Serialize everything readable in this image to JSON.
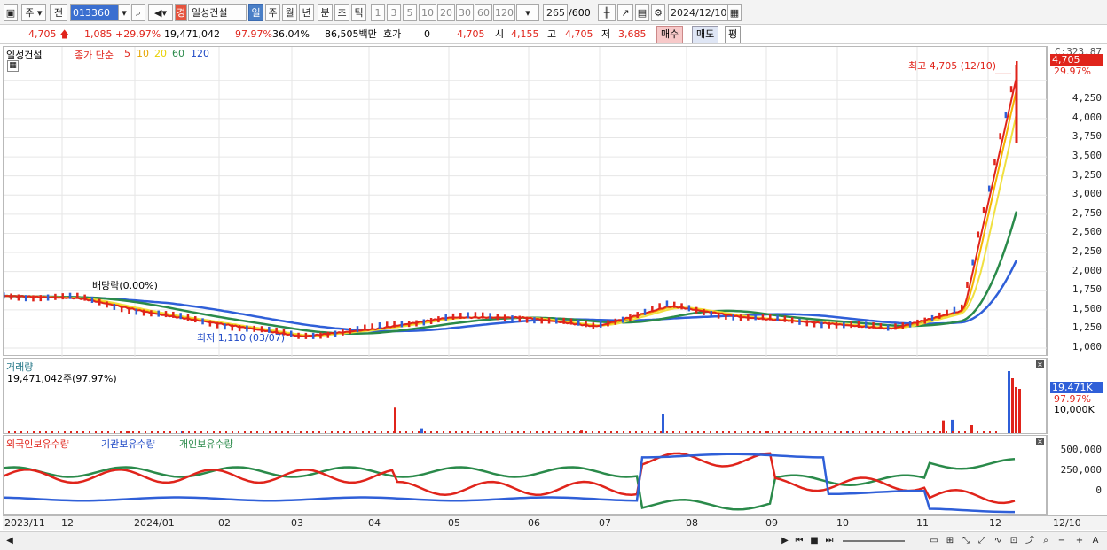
{
  "toolbar": {
    "market": "주",
    "period_prefix": "전",
    "code": "013360",
    "name": "일성건설",
    "name_badge": "경",
    "periods": [
      "일",
      "주",
      "월",
      "년",
      "분",
      "초",
      "틱"
    ],
    "minutes": [
      "1",
      "3",
      "5",
      "10",
      "20",
      "30",
      "60",
      "120"
    ],
    "count": "265",
    "count_max": "/600",
    "date": "2024/12/10"
  },
  "quote": {
    "price": "4,705",
    "change": "1,085",
    "change_pct": "+29.97%",
    "volume": "19,471,042",
    "vol_ratio": "97.97%",
    "turnover": "36.04%",
    "amount": "86,505백만",
    "hoga_label": "호가",
    "hoga_value": "0",
    "ask": "4,705",
    "open_label": "시",
    "open": "4,155",
    "high_label": "고",
    "high": "4,705",
    "low_label": "저",
    "low": "3,685",
    "buy": "매수",
    "sell": "매도",
    "avg": "평"
  },
  "price_panel": {
    "stock_name": "일성건설",
    "ma_label": "종가 단순",
    "ma_periods": [
      "5",
      "10",
      "20",
      "60",
      "120"
    ],
    "ma_colors": [
      "#e0241b",
      "#f5b400",
      "#f0e040",
      "#2a8a4a",
      "#2f5fd8"
    ],
    "annotation_high": "최고 4,705 (12/10)",
    "annotation_low": "최저 1,110 (03/07)",
    "annotation_div": "배당락(0.00%)",
    "axis_top": "C:323.87",
    "current_tag": "4,705",
    "current_pct": "29.97%"
  },
  "volume_panel": {
    "title": "거래량",
    "value": "19,471,042주(97.97%)",
    "tag": "19,471K",
    "tag_pct": "97.97%",
    "axis_label": "10,000K"
  },
  "inst_panel": {
    "labels": [
      "외국인보유수량",
      "기관보유수량",
      "개인보유수량"
    ],
    "colors": [
      "#e0241b",
      "#2f5fd8",
      "#2a8a4a"
    ],
    "ticks": [
      "500,000",
      "250,000",
      "0"
    ]
  },
  "x_labels": [
    "2023/11",
    "12",
    "2024/01",
    "02",
    "03",
    "04",
    "05",
    "06",
    "07",
    "08",
    "09",
    "10",
    "11",
    "12",
    "12/10"
  ],
  "chart_data": {
    "type": "line",
    "title": "일성건설",
    "ylim": [
      1000,
      4705
    ],
    "y_ticks": [
      1000,
      1250,
      1500,
      1750,
      2000,
      2250,
      2500,
      2750,
      3000,
      3250,
      3500,
      3750,
      4000,
      4250,
      4500
    ],
    "months": [
      "2023/11",
      "12",
      "2024/01",
      "02",
      "03",
      "04",
      "05",
      "06",
      "07",
      "08",
      "09",
      "10",
      "11",
      "12"
    ],
    "close": [
      1680,
      1650,
      1450,
      1300,
      1150,
      1250,
      1400,
      1400,
      1280,
      1550,
      1400,
      1330,
      1250,
      1500,
      4705
    ],
    "volume_peaks_k": [
      500,
      300,
      8000,
      1500,
      800,
      6000,
      500,
      300,
      4000,
      4200,
      2500,
      19471
    ]
  }
}
